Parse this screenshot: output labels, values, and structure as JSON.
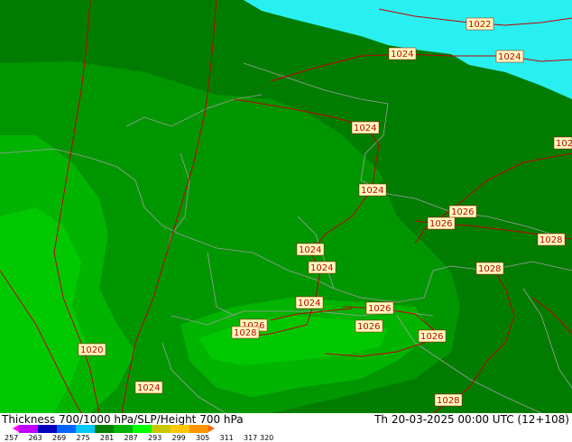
{
  "map": {
    "title": "Thickness 700/1000 hPa/SLP/Height 700 hPa",
    "valid_time": "Th 20-03-2025 00:00 UTC (12+108)",
    "colors": {
      "sea": "#29f0f0",
      "thickness_dark": "#007d00",
      "thickness_mid": "#009600",
      "thickness_light": "#00b400",
      "thickness_bright": "#00c800",
      "isobar": "#c00000",
      "borders": "#a0a0a0",
      "label_bg": "#ffffc0"
    },
    "isobar_labels": [
      {
        "text": "1022"
      },
      {
        "text": "1024"
      },
      {
        "text": "1024"
      },
      {
        "text": "1024"
      },
      {
        "text": "1024"
      },
      {
        "text": "1024"
      },
      {
        "text": "1024"
      },
      {
        "text": "1024"
      },
      {
        "text": "1024"
      },
      {
        "text": "1024"
      },
      {
        "text": "1020"
      },
      {
        "text": "1026"
      },
      {
        "text": "1026"
      },
      {
        "text": "1026"
      },
      {
        "text": "1026"
      },
      {
        "text": "1026"
      },
      {
        "text": "1026"
      },
      {
        "text": "1028"
      },
      {
        "text": "1028"
      },
      {
        "text": "1028"
      },
      {
        "text": "1028"
      },
      {
        "text": "102"
      }
    ],
    "legend": {
      "ticks": [
        "257",
        "263",
        "269",
        "275",
        "281",
        "287",
        "293",
        "299",
        "305",
        "311",
        "317",
        "320"
      ],
      "colors": [
        "#ff00ff",
        "#c000ff",
        "#0000c0",
        "#0064ff",
        "#00c8ff",
        "#008000",
        "#00b400",
        "#00ff00",
        "#c8c800",
        "#ffc800",
        "#ff9600",
        "#ff6400"
      ]
    }
  }
}
